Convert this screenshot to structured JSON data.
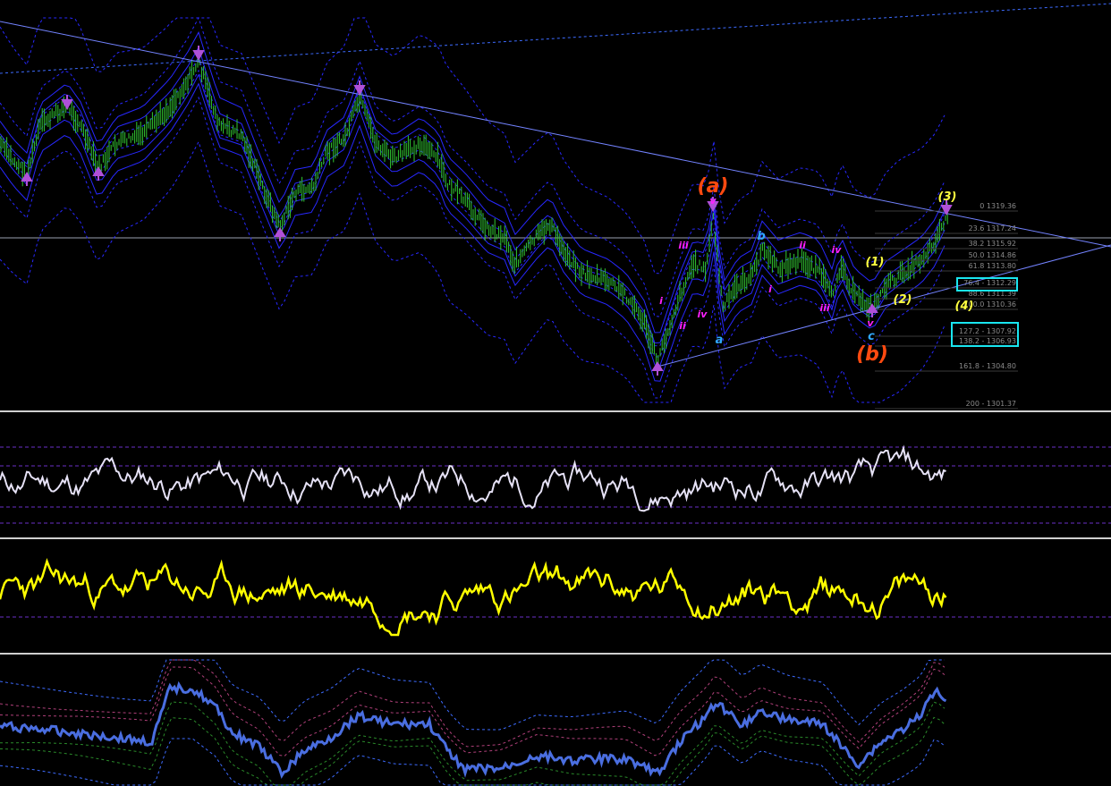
{
  "colors": {
    "background": "#000000",
    "bars": "#32c832",
    "bands": "#2828ff",
    "trendlines": "#6a7cff",
    "fib_text": "#8a8a8a",
    "fib_box": "#19e6f0",
    "divider": "#cfcfcf",
    "osc1": "#e6e2f6",
    "osc2": "#ffff00",
    "osc3": "#4a6ee0"
  },
  "icons": {
    "pivot_high": "down-arrow-icon",
    "pivot_low": "up-arrow-icon"
  },
  "chart_data": [
    {
      "type": "line",
      "panel": "price",
      "title": "",
      "fib_levels": [
        {
          "ratio": "0",
          "price": "1319.36",
          "label": "0 1319.36"
        },
        {
          "ratio": "23.6",
          "price": "1317.24",
          "label": "23.6 1317.24"
        },
        {
          "ratio": "38.2",
          "price": "1315.92",
          "label": "38.2 1315.92"
        },
        {
          "ratio": "50.0",
          "price": "1314.86",
          "label": "50.0 1314.86"
        },
        {
          "ratio": "61.8",
          "price": "1313.80",
          "label": "61.8 1313.80"
        },
        {
          "ratio": "76.4",
          "price": "1312.29",
          "label": "76.4 - 1312.29"
        },
        {
          "ratio": "88.6",
          "price": "1311.39",
          "label": "88.6 1311.39"
        },
        {
          "ratio": "100.0",
          "price": "1310.36",
          "label": "100.0 1310.36"
        },
        {
          "ratio": "127.2",
          "price": "1307.92",
          "label": "127.2 - 1307.92"
        },
        {
          "ratio": "138.2",
          "price": "1306.93",
          "label": "138.2 - 1306.93"
        },
        {
          "ratio": "161.8",
          "price": "1304.80",
          "label": "161.8 - 1304.80"
        },
        {
          "ratio": "200",
          "price": "1301.37",
          "label": "200 - 1301.37"
        }
      ],
      "wave_labels": [
        {
          "text": "(a)",
          "color": "#ff4a10"
        },
        {
          "text": "(b)",
          "color": "#ff4a10"
        },
        {
          "text": "(1)",
          "color": "#ffff40"
        },
        {
          "text": "(2)",
          "color": "#ffff40"
        },
        {
          "text": "(3)",
          "color": "#ffff40"
        },
        {
          "text": "(4)",
          "color": "#ffff40"
        },
        {
          "text": "a",
          "color": "#30a8ff"
        },
        {
          "text": "b",
          "color": "#30a8ff"
        },
        {
          "text": "c",
          "color": "#30a8ff"
        },
        {
          "text": "i",
          "color": "#ff20ff"
        },
        {
          "text": "ii",
          "color": "#ff20ff"
        },
        {
          "text": "iii",
          "color": "#ff20ff"
        },
        {
          "text": "iv",
          "color": "#ff20ff"
        },
        {
          "text": "v",
          "color": "#ff20ff"
        },
        {
          "text": "i",
          "color": "#ff20ff"
        },
        {
          "text": "ii",
          "color": "#ff20ff"
        },
        {
          "text": "iii",
          "color": "#ff20ff"
        },
        {
          "text": "iv",
          "color": "#ff20ff"
        },
        {
          "text": "v",
          "color": "#ff20ff"
        }
      ]
    },
    {
      "type": "line",
      "panel": "oscillator-1"
    },
    {
      "type": "line",
      "panel": "oscillator-2"
    },
    {
      "type": "line",
      "panel": "oscillator-3"
    }
  ]
}
